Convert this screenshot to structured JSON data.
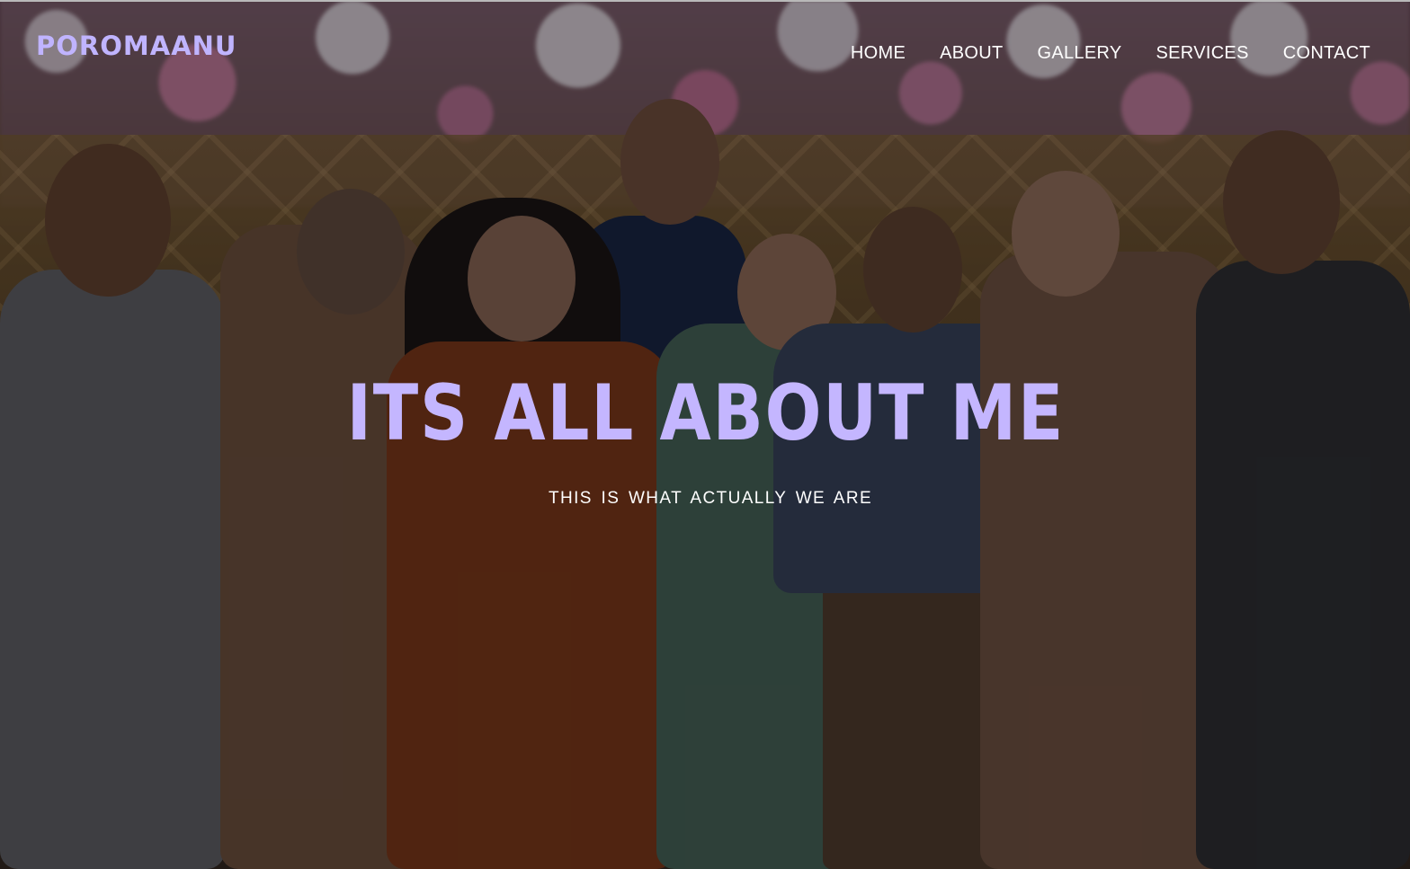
{
  "site": {
    "brand": "POROMAANU",
    "brand_color": "#c0b4ff"
  },
  "nav": {
    "items": [
      {
        "label": "HOME"
      },
      {
        "label": "ABOUT"
      },
      {
        "label": "GALLERY"
      },
      {
        "label": "SERVICES"
      },
      {
        "label": "CONTACT"
      }
    ]
  },
  "hero": {
    "headline": "ITS ALL ABOUT ME",
    "subline": "THIS IS WHAT ACTUALLY WE ARE",
    "headline_color": "#c4b6ff",
    "background_image": "family group photo"
  }
}
